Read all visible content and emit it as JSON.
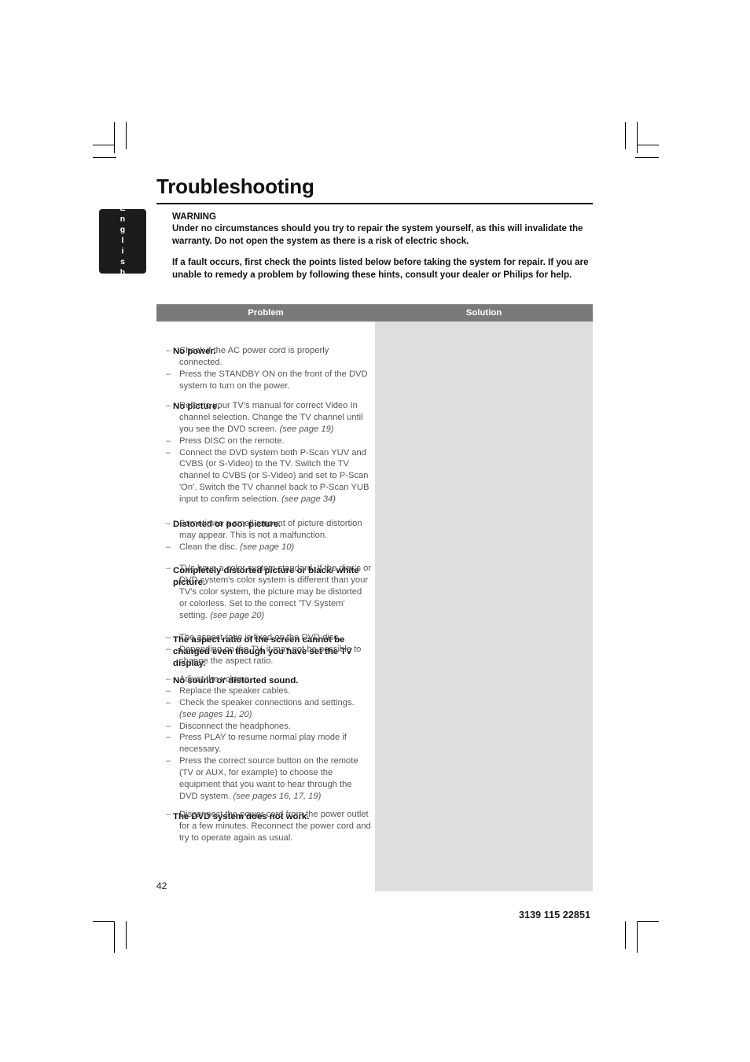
{
  "page": {
    "title": "Troubleshooting",
    "page_number": "42",
    "doc_code": "3139 115 22851",
    "language_tab": "English"
  },
  "warning": {
    "heading": "WARNING",
    "paragraph1": "Under no circumstances should you try to repair the system yourself, as this will invalidate the warranty.  Do not open the system as there is a risk of electric shock.",
    "paragraph2": "If a fault occurs, first check the points listed below before taking the system for repair. If you are unable to remedy a problem by following these hints, consult your dealer or Philips for help."
  },
  "table": {
    "headers": {
      "problem": "Problem",
      "solution": "Solution"
    },
    "colors": {
      "header_bg": "#7a7a7a",
      "solution_bg": "#dedede",
      "solution_text": "#555555"
    },
    "rows": [
      {
        "problem": "No power.",
        "solutions": [
          "Check if the AC power cord is properly connected.",
          "Press the STANDBY ON on the front of the DVD system to turn on the power."
        ]
      },
      {
        "problem": "No picture.",
        "solutions": [
          "Refer to your TV's manual for correct Video In channel selection.  Change the TV channel until you see the DVD screen.  <i>(see page 19)</i>",
          "Press DISC on the remote.",
          "Connect the DVD system both P-Scan YUV and CVBS (or S-Video) to the TV. Switch the TV channel to CVBS (or S-Video) and set to P-Scan 'On'. Switch the TV channel back to P-Scan YUB input to confirm selection.  <i>(see page 34)</i>"
        ]
      },
      {
        "problem": "Distorted or poor picture.",
        "solutions": [
          "Sometimes a small amount of picture distortion may appear. This is not a malfunction.",
          "Clean the disc.  <i>(see page 10)</i>"
        ]
      },
      {
        "problem": "Completely distorted picture or black/ white picture.",
        "solutions": [
          "TVs have a color system standard.  If the disc's or DVD system's color system is different than your TV's color system, the picture may be distorted or colorless.  Set to the correct 'TV System' setting. <i>(see page 20)</i>"
        ]
      },
      {
        "problem": "The aspect ratio of the screen cannot be changed even though you have set the TV display.",
        "solutions": [
          "The aspect ratio is fixed on the DVD disc.",
          "Depending on the TV, it may not be possible to change the aspect ratio."
        ]
      },
      {
        "problem": "No sound or distorted sound.",
        "solutions": [
          "Adjust the volume.",
          "Replace the speaker cables.",
          "Check the speaker connections and settings. <i>(see pages 11, 20)</i>",
          "Disconnect the headphones.",
          "Press PLAY to resume normal play mode if necessary.",
          "Press the correct source button on the remote (TV or AUX, for example) to choose the equipment that you want to hear through the DVD system. <i>(see pages 16, 17, 19)</i>"
        ]
      },
      {
        "problem": "The DVD system does not work.",
        "solutions": [
          "Disconnect the power cord from the power outlet for a few minutes.  Reconnect the power cord and try to operate again as usual."
        ]
      }
    ]
  }
}
